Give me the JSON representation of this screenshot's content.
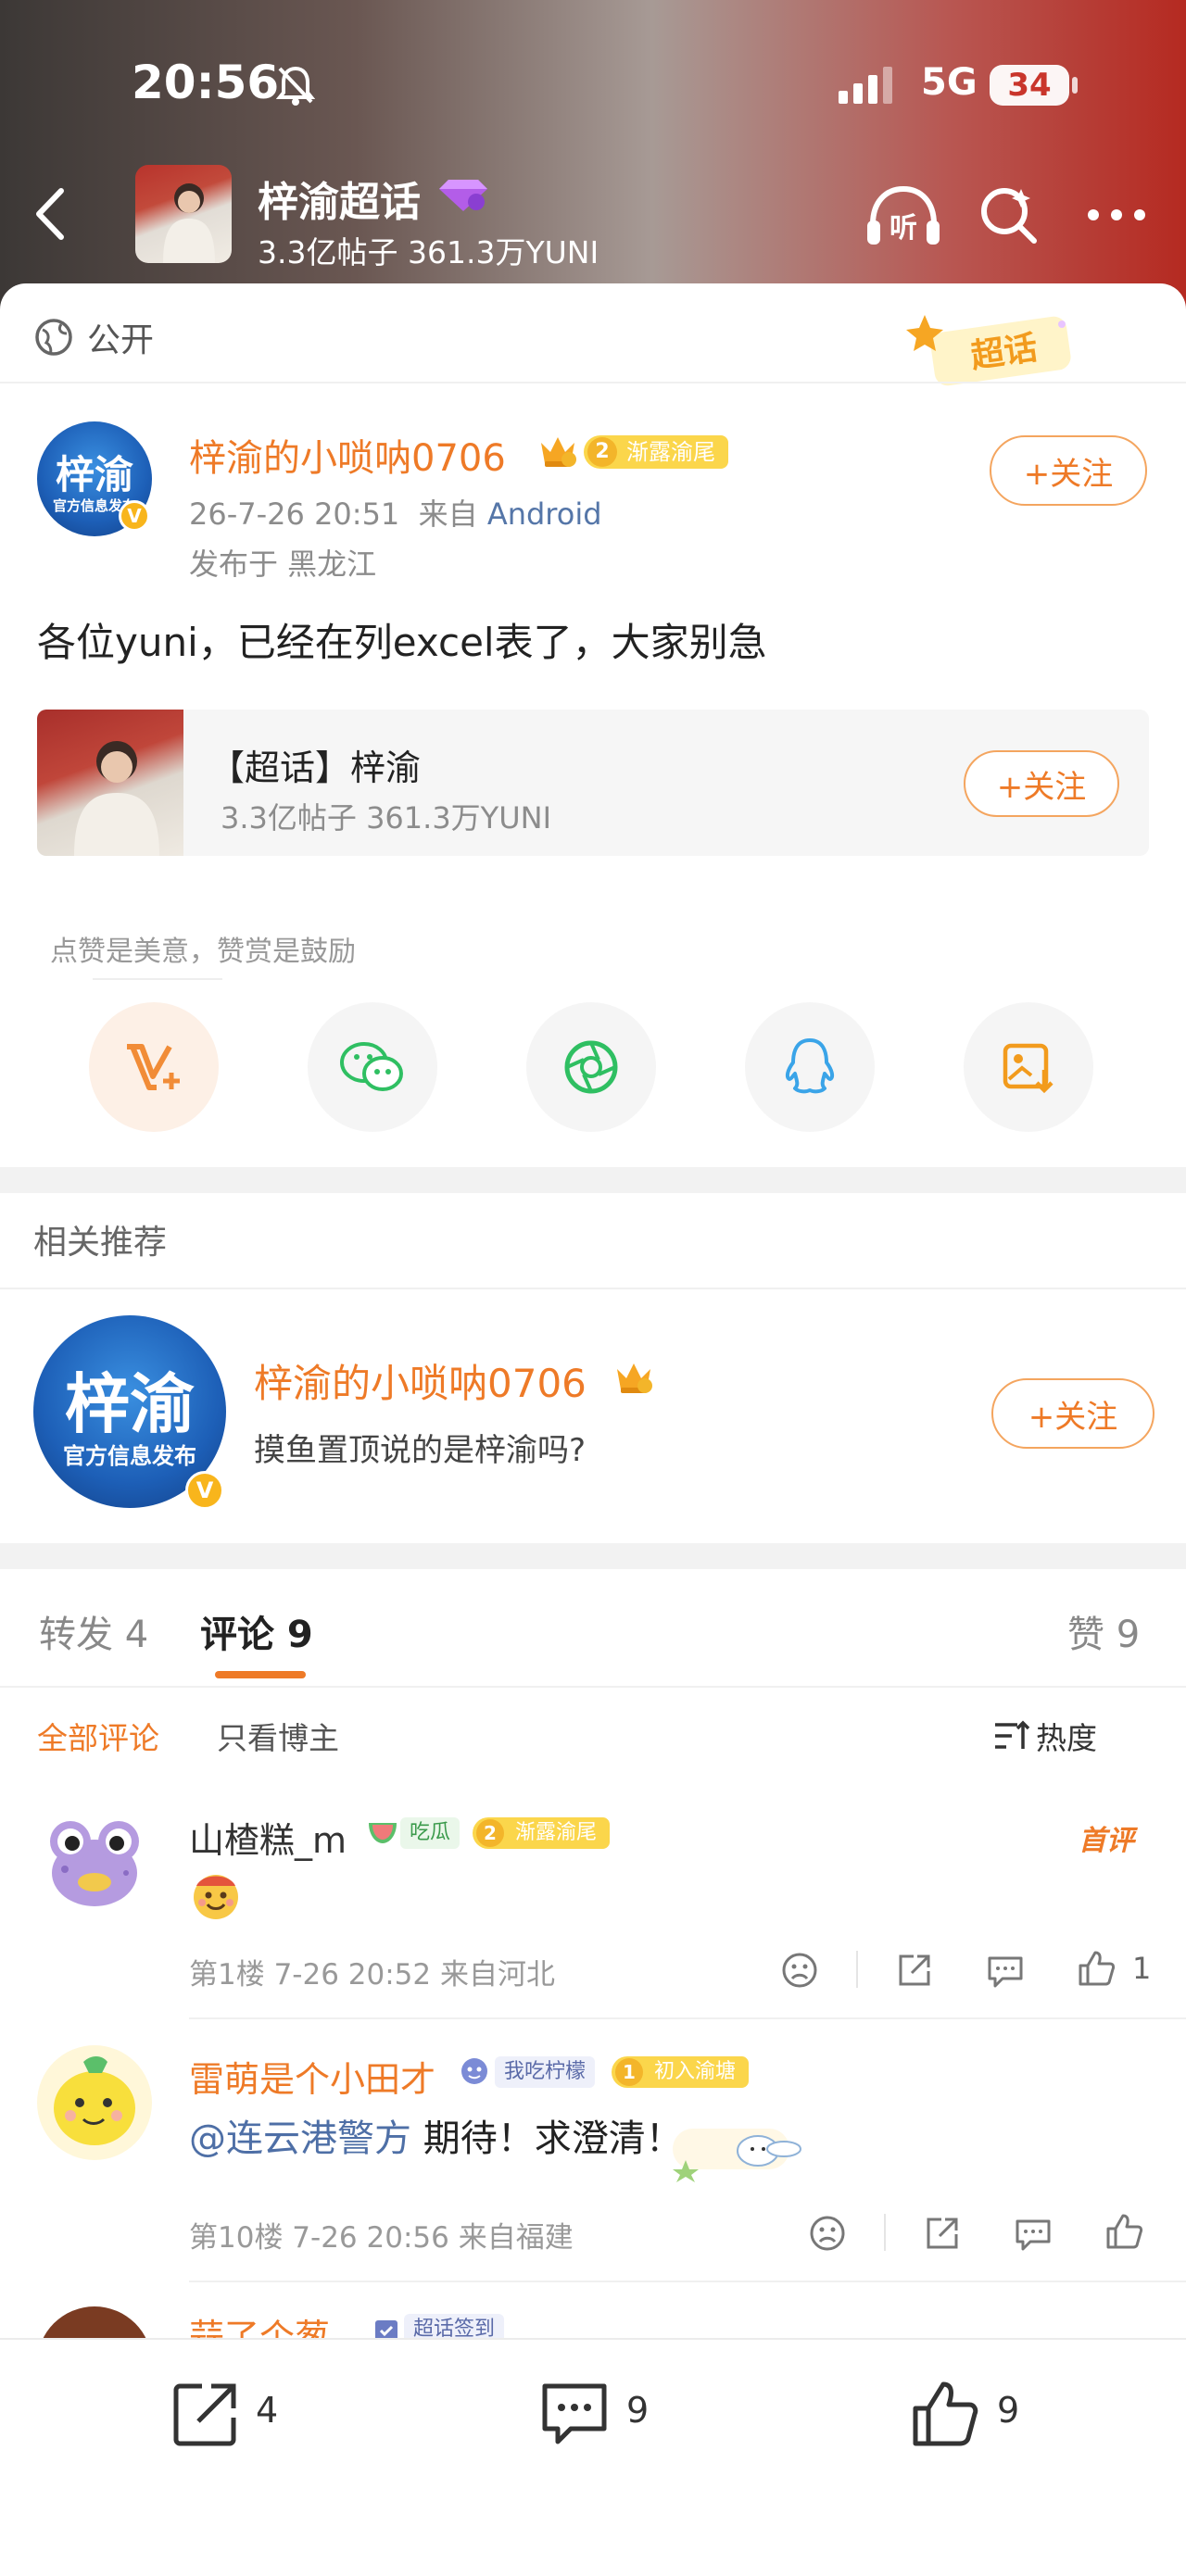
{
  "status_bar": {
    "time": "20:56",
    "network": "5G",
    "battery": "34"
  },
  "header": {
    "topic_title": "梓渝超话",
    "topic_sub": "3.3亿帖子 361.3万YUNI"
  },
  "post": {
    "visibility": "公开",
    "badge": "超话",
    "author_name": "梓渝的小唢呐0706",
    "author_level": "2",
    "author_level_tag": "渐露渝尾",
    "avatar_text_big": "梓渝",
    "avatar_text_small": "官方信息发布",
    "verified_mark": "V",
    "time": "26-7-26 20:51",
    "source_prefix": "来自",
    "source": "Android",
    "location": "发布于 黑龙江",
    "follow_label": "+关注",
    "text": "各位yuni，已经在列excel表了，大家别急"
  },
  "topic_card": {
    "title": "【超话】梓渝",
    "sub": "3.3亿帖子 361.3万YUNI",
    "follow_label": "+关注"
  },
  "reward": {
    "text": "点赞是美意，赞赏是鼓励"
  },
  "share_icons": [
    "reward-v-icon",
    "wechat-icon",
    "moments-icon",
    "qq-icon",
    "save-image-icon"
  ],
  "related": {
    "header": "相关推荐",
    "name": "梓渝的小唢呐0706",
    "desc": "摸鱼置顶说的是梓渝吗?",
    "follow_label": "+关注"
  },
  "tabs": {
    "repost": "转发 4",
    "comments": "评论 9",
    "likes": "赞 9"
  },
  "filters": {
    "all": "全部评论",
    "author_only": "只看博主",
    "sort": "热度"
  },
  "comments": [
    {
      "name": "山楂糕_m",
      "tag1": "吃瓜",
      "level": "2",
      "level_tag": "渐露渝尾",
      "first_label": "首评",
      "text": "",
      "meta": "第1楼 7-26 20:52 来自河北",
      "likes": "1"
    },
    {
      "name": "雷萌是个小田才",
      "tag1": "我吃柠檬",
      "level": "1",
      "level_tag": "初入渝塘",
      "mention": "@连云港警方",
      "text": " 期待！求澄清！",
      "meta": "第10楼 7-26 20:56 来自福建",
      "likes": ""
    },
    {
      "name": "蒜了个葱",
      "tag1": "超话签到"
    }
  ],
  "bottom_bar": {
    "reposts": "4",
    "comments": "9",
    "likes": "9"
  },
  "colors": {
    "accent": "#ee7a27",
    "link": "#4e6fa6",
    "gold": "#fbd64b"
  }
}
